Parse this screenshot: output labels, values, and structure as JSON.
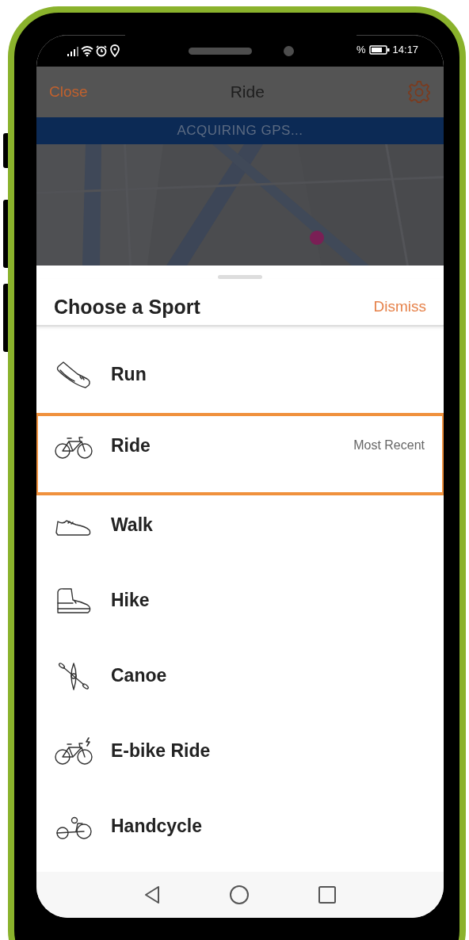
{
  "status_bar": {
    "battery_percent": "%",
    "time": "14:17"
  },
  "header": {
    "close": "Close",
    "title": "Ride"
  },
  "gps_banner": "ACQUIRING GPS...",
  "sheet": {
    "title": "Choose a Sport",
    "dismiss": "Dismiss",
    "sports": [
      {
        "label": "Run",
        "selected": false
      },
      {
        "label": "Ride",
        "selected": true,
        "note": "Most Recent"
      },
      {
        "label": "Walk",
        "selected": false
      },
      {
        "label": "Hike",
        "selected": false
      },
      {
        "label": "Canoe",
        "selected": false
      },
      {
        "label": "E-bike Ride",
        "selected": false
      },
      {
        "label": "Handcycle",
        "selected": false
      }
    ]
  }
}
